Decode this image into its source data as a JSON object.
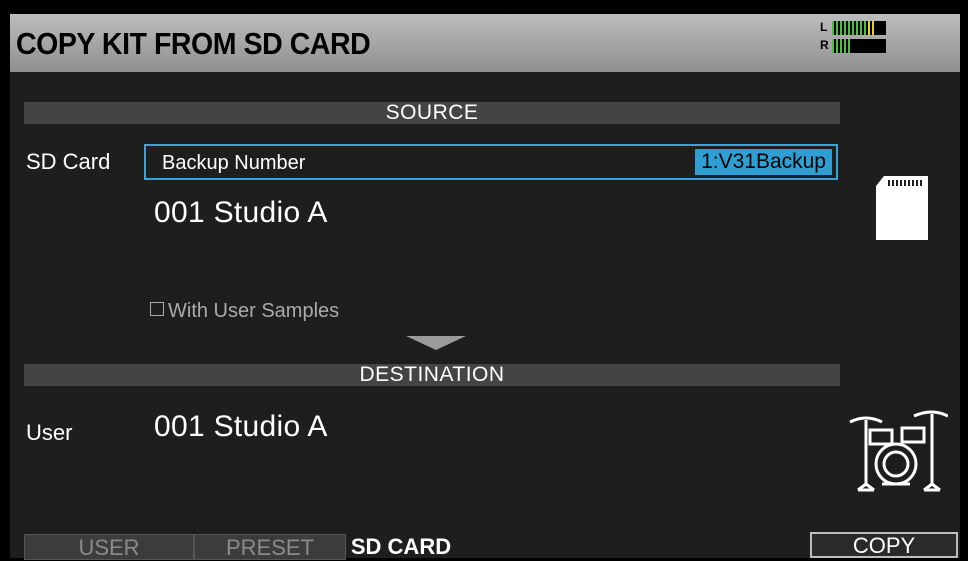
{
  "title": "COPY KIT FROM SD CARD",
  "meter": {
    "left_label": "L",
    "right_label": "R",
    "left_level": 0.85,
    "right_level": 0.35
  },
  "source": {
    "header": "SOURCE",
    "row_label": "SD Card",
    "field_label": "Backup Number",
    "field_value": "1:V31Backup",
    "kit_name": "001 Studio A",
    "checkbox_label": "With User Samples",
    "checkbox_checked": false,
    "icon": "sd-card-icon"
  },
  "destination": {
    "header": "DESTINATION",
    "row_label": "User",
    "kit_name": "001 Studio A",
    "icon": "drum-kit-icon"
  },
  "tabs": [
    {
      "label": "USER",
      "active": false
    },
    {
      "label": "PRESET",
      "active": false
    },
    {
      "label": "SD CARD",
      "active": true
    }
  ],
  "copy_button": "COPY",
  "colors": {
    "accent": "#2f9fd3",
    "title_bar": "#a8a8a8",
    "section_bar": "#444444",
    "meter_green": "#49c23a",
    "meter_yellow": "#e6d21e"
  }
}
